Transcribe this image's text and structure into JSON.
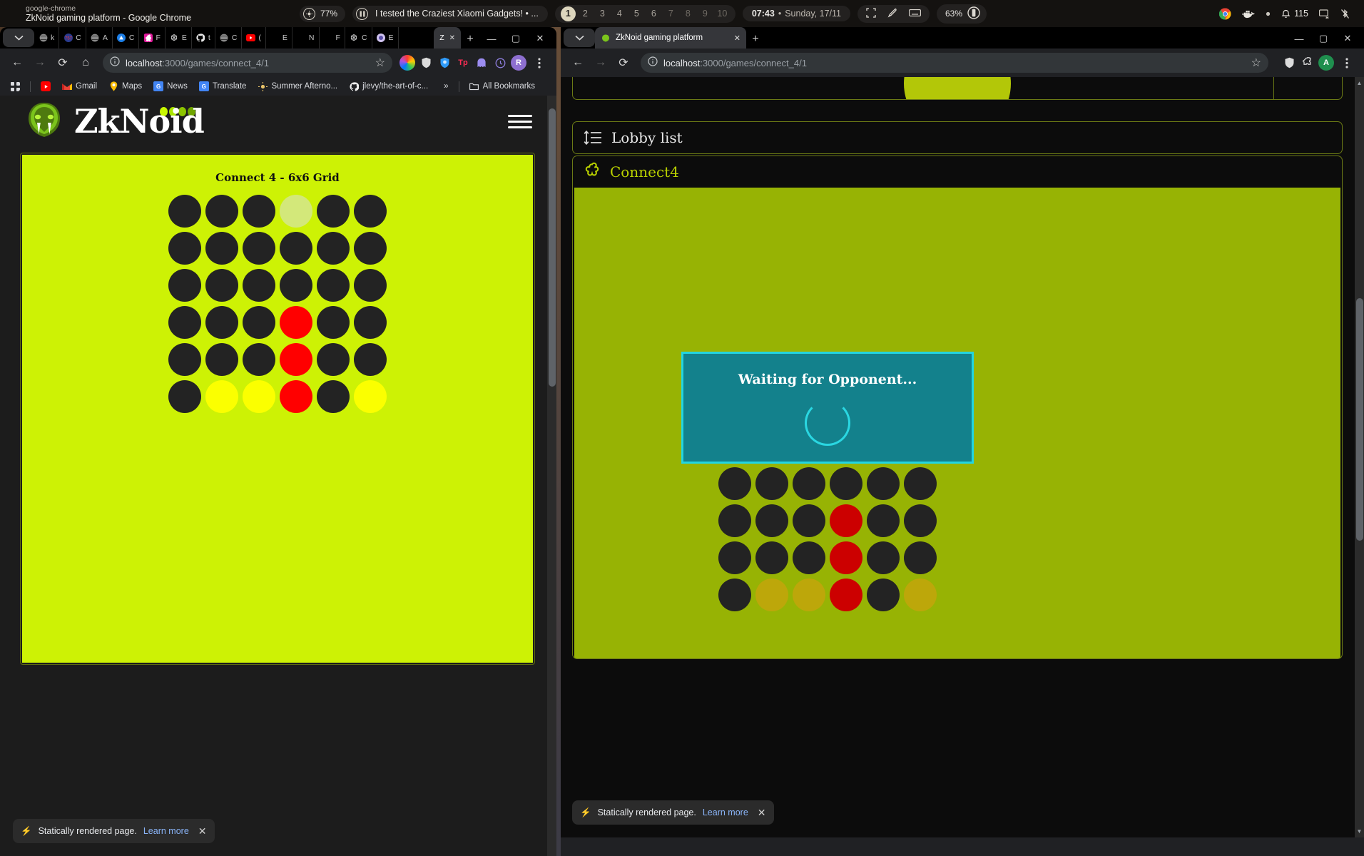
{
  "topbar": {
    "app_class": "google-chrome",
    "window_title": "ZkNoid gaming platform - Google Chrome",
    "brightness": "77%",
    "media_title": "I tested the Craziest Xiaomi Gadgets! • ...",
    "workspaces": [
      "1",
      "2",
      "3",
      "4",
      "5",
      "6",
      "7",
      "8",
      "9",
      "10"
    ],
    "active_workspace": "1",
    "clock_time": "07:43",
    "clock_sep": "•",
    "clock_date": "Sunday, 17/11",
    "battery": "63%",
    "notification_count": "115"
  },
  "left_window": {
    "tabs": [
      {
        "label": "k",
        "fav": "globe",
        "color": "#8a8a8a"
      },
      {
        "label": "C",
        "fav": "757",
        "color": "#d82b2b"
      },
      {
        "label": "A",
        "fav": "globe",
        "color": "#8a8a8a"
      },
      {
        "label": "C",
        "fav": "triangle",
        "color": "#2979ff"
      },
      {
        "label": "F",
        "fav": "flower",
        "color": "#e0199b"
      },
      {
        "label": "E",
        "fav": "openai",
        "color": "#9b9b9b"
      },
      {
        "label": "t",
        "fav": "github",
        "color": "#e8e8e8"
      },
      {
        "label": "C",
        "fav": "globe",
        "color": "#8a8a8a"
      },
      {
        "label": "(",
        "fav": "youtube",
        "color": "#ff0000"
      },
      {
        "label": "E",
        "fav": "none",
        "color": "#555"
      },
      {
        "label": "N",
        "fav": "none",
        "color": "#555"
      },
      {
        "label": "F",
        "fav": "none",
        "color": "#555"
      },
      {
        "label": "C",
        "fav": "openai",
        "color": "#9b9b9b"
      },
      {
        "label": "E",
        "fav": "prism",
        "color": "#c0a6e0"
      }
    ],
    "active_tab": {
      "label": "Z",
      "close": "✕"
    },
    "new_tab": "+",
    "window_buttons": {
      "minimize": "—",
      "maximize": "▢",
      "close": "✕"
    },
    "omnibox": {
      "back": "←",
      "forward": "→",
      "reload": "⟳",
      "home": "⌂",
      "info_icon": "info-circle",
      "url_host": "localhost",
      "url_path": ":3000/games/connect_4/1",
      "star": "☆",
      "profile_letter": "R"
    },
    "bookmarks": [
      {
        "label": "",
        "icon": "apps-grid"
      },
      {
        "label": "",
        "icon": "youtube"
      },
      {
        "label": "Gmail",
        "icon": "gmail"
      },
      {
        "label": "Maps",
        "icon": "maps"
      },
      {
        "label": "News",
        "icon": "news"
      },
      {
        "label": "Translate",
        "icon": "translate"
      },
      {
        "label": "Summer Afterno...",
        "icon": "sun"
      },
      {
        "label": "jlevy/the-art-of-c...",
        "icon": "github"
      }
    ],
    "bookmarks_overflow": "»",
    "all_bookmarks": "All Bookmarks",
    "all_bookmarks_icon": "folder-icon",
    "page": {
      "brand": "ZkNoid",
      "logo_icon": "snake-head-icon",
      "menu_icon": "hamburger-icon"
    },
    "toast": {
      "bolt": "⚡",
      "text": "Statically rendered page.",
      "link": "Learn more",
      "close": "✕"
    }
  },
  "right_window": {
    "tab_label": "ZkNoid gaming platform",
    "tab_close": "✕",
    "new_tab": "+",
    "window_buttons": {
      "minimize": "—",
      "maximize": "▢",
      "close": "✕"
    },
    "omnibox": {
      "back": "←",
      "forward": "→",
      "reload": "⟳",
      "info_icon": "info-circle",
      "url_host": "localhost",
      "url_path": ":3000/games/connect_4/1",
      "star": "☆",
      "profile_letter": "A"
    },
    "lobby": {
      "title": "Lobby list",
      "icon": "sort-list-icon"
    },
    "game": {
      "name": "Connect4",
      "icon": "flower-icon"
    },
    "modal": {
      "title": "Waiting for Opponent...",
      "spinner": "loading-spinner"
    },
    "toast": {
      "bolt": "⚡",
      "text": "Statically rendered page.",
      "link": "Learn more",
      "close": "✕"
    }
  },
  "game_state": {
    "left_board": {
      "title": "Connect 4 - 6x6 Grid",
      "rows": 6,
      "cols": 6,
      "board_color": "#cdf205",
      "empty_color": "#232323",
      "red_color": "#ff0000",
      "yellow_color": "#fbff00",
      "hover_color": "#d3e87a",
      "cells": [
        [
          "empty",
          "empty",
          "empty",
          "hover",
          "empty",
          "empty"
        ],
        [
          "empty",
          "empty",
          "empty",
          "empty",
          "empty",
          "empty"
        ],
        [
          "empty",
          "empty",
          "empty",
          "empty",
          "empty",
          "empty"
        ],
        [
          "empty",
          "empty",
          "empty",
          "red",
          "empty",
          "empty"
        ],
        [
          "empty",
          "empty",
          "empty",
          "red",
          "empty",
          "empty"
        ],
        [
          "empty",
          "yellow",
          "yellow",
          "red",
          "empty",
          "yellow"
        ]
      ]
    },
    "right_board": {
      "rows": 4,
      "cols": 6,
      "board_color": "#97b304",
      "empty_color": "#232323",
      "red_color": "#cc0000",
      "yellow_color": "#bda70a",
      "cells": [
        [
          "empty",
          "empty",
          "empty",
          "empty",
          "empty",
          "empty"
        ],
        [
          "empty",
          "empty",
          "empty",
          "red",
          "empty",
          "empty"
        ],
        [
          "empty",
          "empty",
          "empty",
          "red",
          "empty",
          "empty"
        ],
        [
          "empty",
          "yellow",
          "yellow",
          "red",
          "empty",
          "yellow"
        ]
      ]
    }
  }
}
